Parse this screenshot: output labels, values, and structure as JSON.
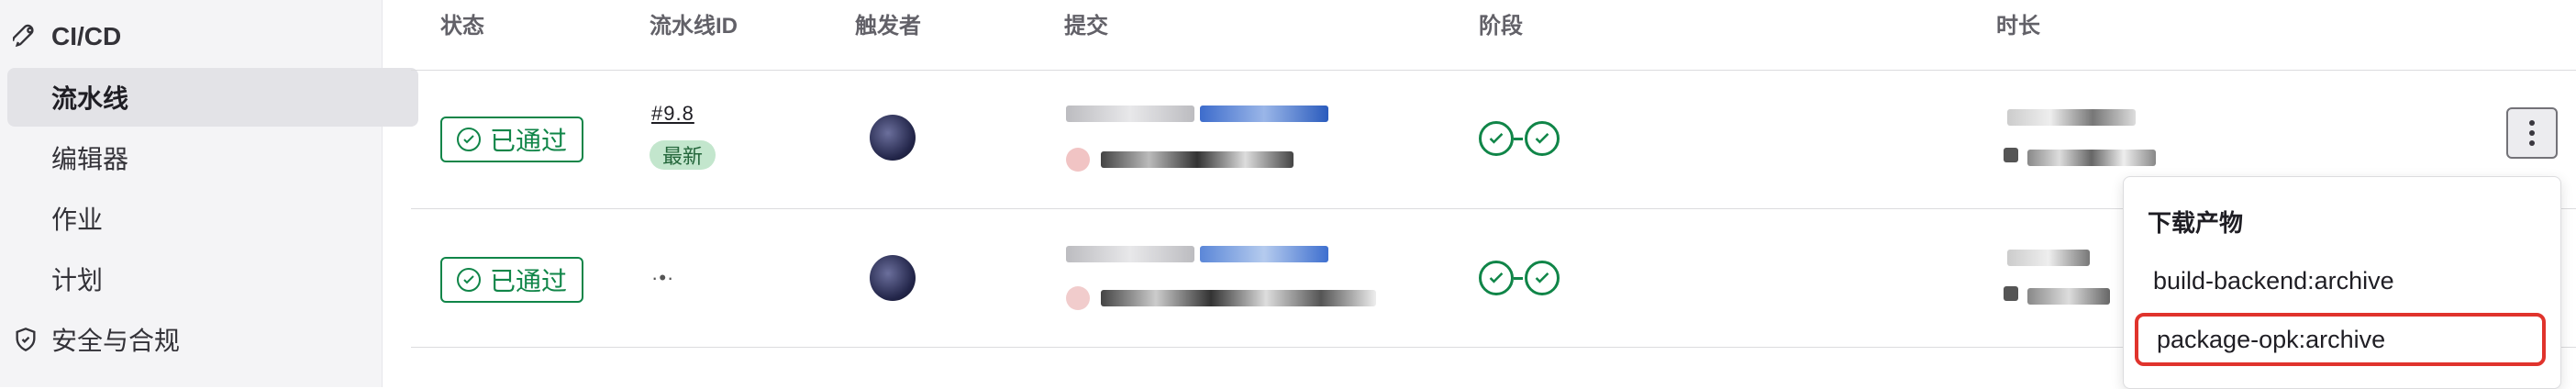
{
  "sidebar": {
    "section_title": "CI/CD",
    "items": [
      {
        "label": "流水线"
      },
      {
        "label": "编辑器"
      },
      {
        "label": "作业"
      },
      {
        "label": "计划"
      }
    ],
    "next_section": "安全与合规"
  },
  "table": {
    "headers": {
      "status": "状态",
      "pipeline_id": "流水线ID",
      "triggerer": "触发者",
      "commit": "提交",
      "stages": "阶段",
      "duration": "时长"
    },
    "rows": [
      {
        "status": "已通过",
        "pipeline_id": "#9.8",
        "latest_tag": "最新"
      },
      {
        "status": "已通过",
        "pipeline_id": "·•·"
      }
    ]
  },
  "dropdown": {
    "title": "下载产物",
    "items": [
      {
        "label": "build-backend:archive"
      },
      {
        "label": "package-opk:archive"
      }
    ]
  },
  "colors": {
    "success": "#108548",
    "highlight": "#e0332c",
    "link": "#1f75cb"
  }
}
